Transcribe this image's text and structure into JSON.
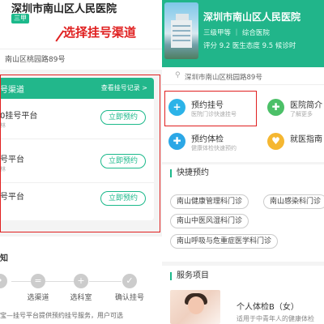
{
  "left": {
    "hospital_title": "深圳市南山区人民医院",
    "grade_badge": "三甲",
    "address": "南山区桃园路89号",
    "annotation": "选择挂号渠道",
    "channels": {
      "title": "号渠道",
      "record_link": "查看挂号记录 >",
      "items": [
        {
          "name": "0挂号平台",
          "sub": "林",
          "action": "立即预约"
        },
        {
          "name": "号平台",
          "sub": "林",
          "action": "立即预约"
        },
        {
          "name": "号平台",
          "sub": "",
          "action": "立即预约"
        }
      ]
    },
    "notice": {
      "title": "知",
      "steps": [
        "",
        "选渠道",
        "选科室",
        "确认挂号"
      ],
      "text": "宝—挂号平台提供预约挂号服务，用户可选"
    }
  },
  "right": {
    "hospital_title": "深圳市南山区人民医院",
    "tags": "三级甲等 ｜ 综合医院",
    "score": "评分 9.2   医生态度 9.5   候诊时",
    "address": "深圳市南山区桃园路89号",
    "grid": [
      {
        "title": "预约挂号",
        "sub": "医院门诊快速挂号",
        "icon": "hospital-icon",
        "color": "#2cb3e8",
        "glyph": "+"
      },
      {
        "title": "医院简介",
        "sub": "了解更多",
        "icon": "briefcase-icon",
        "color": "#4cc068",
        "glyph": "✚"
      },
      {
        "title": "预约体检",
        "sub": "健康体检快速预约",
        "icon": "checkup-icon",
        "color": "#2ba7e6",
        "glyph": "✚"
      },
      {
        "title": "就医指南",
        "sub": "",
        "icon": "heart-icon",
        "color": "#f5b731",
        "glyph": "♥"
      }
    ],
    "quick": {
      "title": "快捷预约",
      "chips": [
        "南山健康管理科门诊",
        "南山感染科门诊",
        "南山中医风湿科门诊",
        "南山呼吸与危重症医学科门诊"
      ]
    },
    "services": {
      "title": "服务项目",
      "item": {
        "name": "个人体检B（女）",
        "desc": "适用于中青年人的健康体检"
      }
    }
  }
}
